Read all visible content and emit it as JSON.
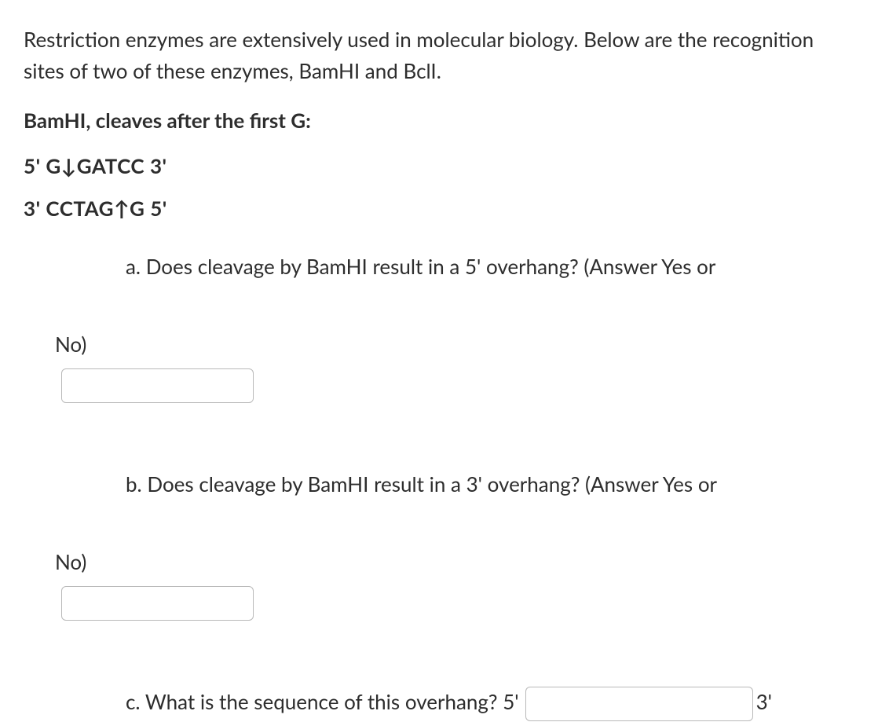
{
  "intro": "Restriction enzymes are extensively used in molecular biology. Below are the recognition sites of two of these enzymes, BamHI and BclI.",
  "enzyme_header": "BamHI, cleaves after the first G:",
  "seq_top": "5' G↓GATCC 3'",
  "seq_bottom": "3' CCTAG↑G 5'",
  "qa": {
    "prefix": "a. Does cleavage by BamHI result in a 5' overhang? (Answer Yes or",
    "trail": "No)"
  },
  "qb": {
    "prefix": "b. Does cleavage by BamHI result in a 3' overhang? (Answer Yes or",
    "trail": "No)"
  },
  "qc": {
    "prefix": "c. What is the sequence of this overhang? 5'",
    "trail": "3'"
  }
}
